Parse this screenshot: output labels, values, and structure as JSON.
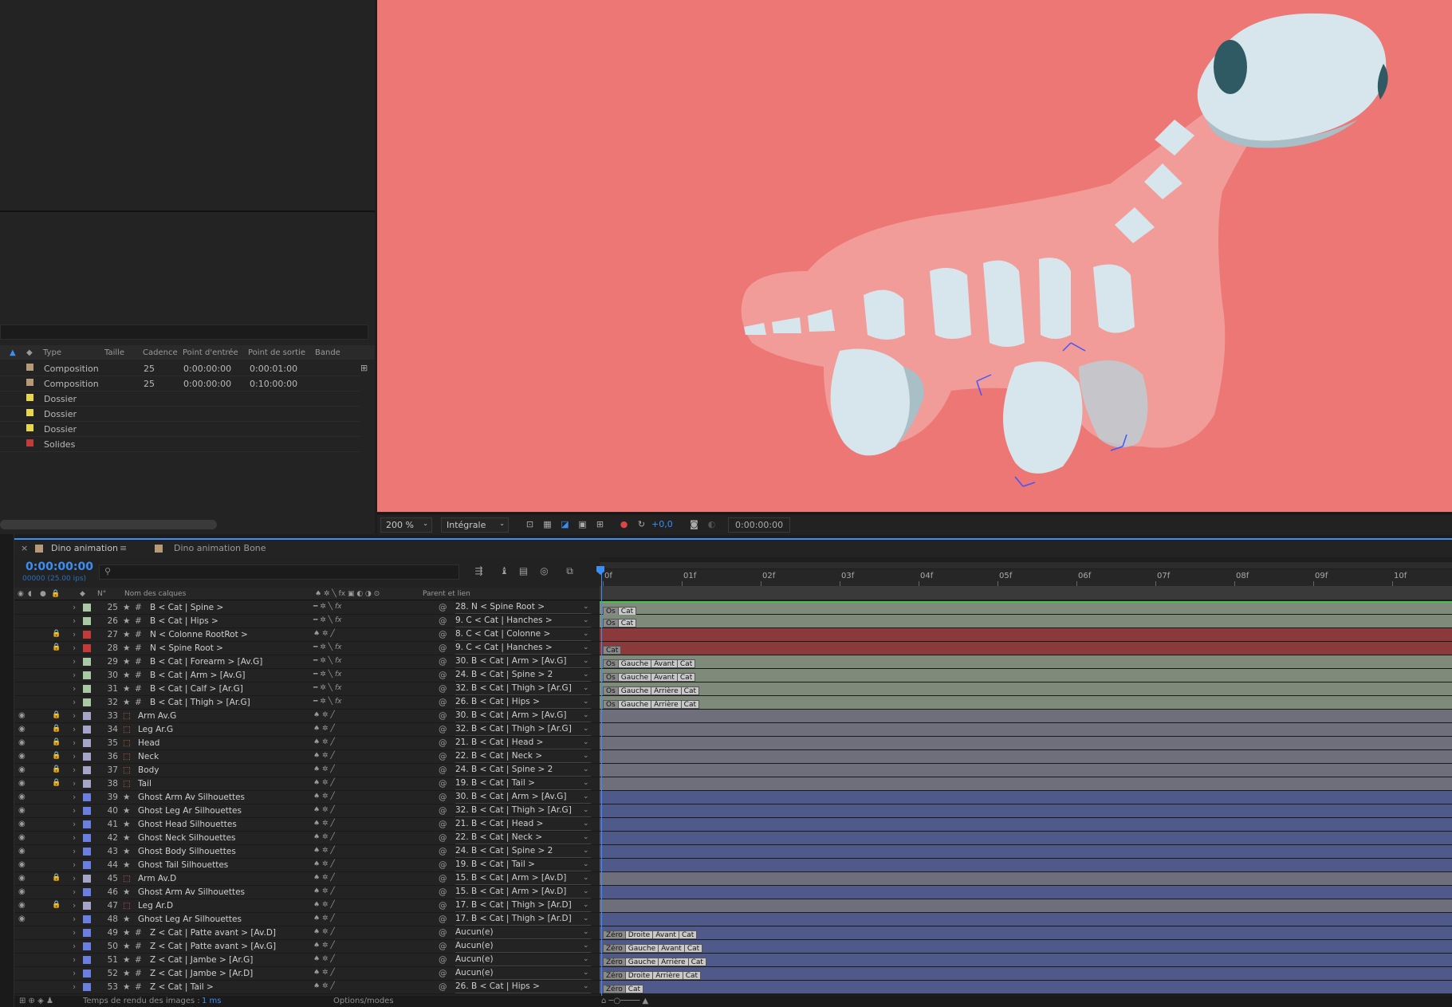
{
  "project": {
    "columns": [
      "Type",
      "Taille",
      "Cadence",
      "Point d'entrée",
      "Point de sortie",
      "Bande"
    ],
    "rows": [
      {
        "type": "Composition",
        "cadence": "25",
        "in": "0:00:00:00",
        "out": "0:00:01:00",
        "color": "#b69a77"
      },
      {
        "type": "Composition",
        "cadence": "25",
        "in": "0:00:00:00",
        "out": "0:10:00:00",
        "color": "#b69a77"
      },
      {
        "type": "Dossier",
        "cadence": "",
        "in": "",
        "out": "",
        "color": "#e5d84a"
      },
      {
        "type": "Dossier",
        "cadence": "",
        "in": "",
        "out": "",
        "color": "#e5d84a"
      },
      {
        "type": "Dossier",
        "cadence": "",
        "in": "",
        "out": "",
        "color": "#e5d84a"
      },
      {
        "type": "Solides",
        "cadence": "",
        "in": "",
        "out": "",
        "color": "#c23b3b"
      }
    ]
  },
  "viewer": {
    "zoom": "200 %",
    "resolution": "Intégrale",
    "exposure": "+0,0",
    "timecode": "0:00:00:00",
    "background_color": "#ec7775"
  },
  "timeline": {
    "tabs": [
      "Dino animation",
      "Dino animation Bone"
    ],
    "current_time": "0:00:00:00",
    "fps": "00000 (25.00 ips)",
    "columns": {
      "num": "N°",
      "name": "Nom des calques",
      "parent": "Parent et lien"
    },
    "ruler": [
      "0f",
      "01f",
      "02f",
      "03f",
      "04f",
      "05f",
      "06f",
      "07f",
      "08f",
      "09f",
      "10f"
    ],
    "footer_render": "Temps de rendu des images :",
    "footer_render_value": "1 ms",
    "footer_toggle": "Options/modes",
    "layers": [
      {
        "num": "25",
        "name": "B < Cat | Spine >",
        "kind": "null",
        "color": "#a9c9a4",
        "eye": false,
        "lock": false,
        "fx": true,
        "parent": "28. N < Spine Root >",
        "bar": "#7e8a7a",
        "tags": [
          "Os",
          "Cat"
        ]
      },
      {
        "num": "26",
        "name": "B < Cat | Hips >",
        "kind": "null",
        "color": "#a9c9a4",
        "eye": false,
        "lock": false,
        "fx": true,
        "parent": "9. C < Cat | Hanches >",
        "bar": "#7e8a7a",
        "tags": [
          "Os",
          "Cat"
        ]
      },
      {
        "num": "27",
        "name": "N < Colonne RootRot >",
        "kind": "null",
        "color": "#c23b3b",
        "eye": false,
        "lock": true,
        "fx": false,
        "parent": "8. C < Cat | Colonne >",
        "bar": "#8a3a3a",
        "tags": []
      },
      {
        "num": "28",
        "name": "N < Spine Root >",
        "kind": "null",
        "color": "#c23b3b",
        "eye": false,
        "lock": true,
        "fx": true,
        "parent": "9. C < Cat | Hanches >",
        "bar": "#8a3a3a",
        "tags": [
          "Cat"
        ]
      },
      {
        "num": "29",
        "name": "B < Cat | Forearm > [Av.G]",
        "kind": "null",
        "color": "#a9c9a4",
        "eye": false,
        "lock": false,
        "fx": true,
        "parent": "30. B < Cat | Arm > [Av.G]",
        "bar": "#7e8a7a",
        "tags": [
          "Os",
          "Gauche",
          "Avant",
          "Cat"
        ]
      },
      {
        "num": "30",
        "name": "B < Cat | Arm > [Av.G]",
        "kind": "null",
        "color": "#a9c9a4",
        "eye": false,
        "lock": false,
        "fx": true,
        "parent": "24. B < Cat | Spine > 2",
        "bar": "#7e8a7a",
        "tags": [
          "Os",
          "Gauche",
          "Avant",
          "Cat"
        ]
      },
      {
        "num": "31",
        "name": "B < Cat | Calf > [Ar.G]",
        "kind": "null",
        "color": "#a9c9a4",
        "eye": false,
        "lock": false,
        "fx": true,
        "parent": "32. B < Cat | Thigh > [Ar.G]",
        "bar": "#7e8a7a",
        "tags": [
          "Os",
          "Gauche",
          "Arrière",
          "Cat"
        ]
      },
      {
        "num": "32",
        "name": "B < Cat | Thigh > [Ar.G]",
        "kind": "null",
        "color": "#a9c9a4",
        "eye": false,
        "lock": false,
        "fx": true,
        "parent": "26. B < Cat | Hips >",
        "bar": "#7e8a7a",
        "tags": [
          "Os",
          "Gauche",
          "Arrière",
          "Cat"
        ]
      },
      {
        "num": "33",
        "name": "Arm Av.G",
        "kind": "shape",
        "color": "#a5a5c8",
        "eye": true,
        "lock": true,
        "fx": false,
        "parent": "30. B < Cat | Arm > [Av.G]",
        "bar": "#6f6f7c",
        "tags": []
      },
      {
        "num": "34",
        "name": "Leg Ar.G",
        "kind": "shape",
        "color": "#a5a5c8",
        "eye": true,
        "lock": true,
        "fx": false,
        "parent": "32. B < Cat | Thigh > [Ar.G]",
        "bar": "#6f6f7c",
        "tags": []
      },
      {
        "num": "35",
        "name": "Head",
        "kind": "shape",
        "color": "#a5a5c8",
        "eye": true,
        "lock": true,
        "fx": false,
        "parent": "21. B < Cat | Head >",
        "bar": "#6f6f7c",
        "tags": []
      },
      {
        "num": "36",
        "name": "Neck",
        "kind": "shape",
        "color": "#a5a5c8",
        "eye": true,
        "lock": true,
        "fx": false,
        "parent": "22. B < Cat | Neck >",
        "bar": "#6f6f7c",
        "tags": []
      },
      {
        "num": "37",
        "name": "Body",
        "kind": "shape",
        "color": "#a5a5c8",
        "eye": true,
        "lock": true,
        "fx": false,
        "parent": "24. B < Cat | Spine > 2",
        "bar": "#6f6f7c",
        "tags": []
      },
      {
        "num": "38",
        "name": "Tail",
        "kind": "shape",
        "color": "#a5a5c8",
        "eye": true,
        "lock": true,
        "fx": false,
        "parent": "19. B < Cat | Tail >",
        "bar": "#6f6f7c",
        "tags": []
      },
      {
        "num": "39",
        "name": "Ghost Arm Av Silhouettes",
        "kind": "star",
        "color": "#6a7fe0",
        "eye": true,
        "lock": false,
        "fx": false,
        "parent": "30. B < Cat | Arm > [Av.G]",
        "bar": "#4f5a8a",
        "tags": []
      },
      {
        "num": "40",
        "name": "Ghost Leg Ar Silhouettes",
        "kind": "star",
        "color": "#6a7fe0",
        "eye": true,
        "lock": false,
        "fx": false,
        "parent": "32. B < Cat | Thigh > [Ar.G]",
        "bar": "#4f5a8a",
        "tags": []
      },
      {
        "num": "41",
        "name": "Ghost Head Silhouettes",
        "kind": "star",
        "color": "#6a7fe0",
        "eye": true,
        "lock": false,
        "fx": false,
        "parent": "21. B < Cat | Head >",
        "bar": "#4f5a8a",
        "tags": []
      },
      {
        "num": "42",
        "name": "Ghost Neck Silhouettes",
        "kind": "star",
        "color": "#6a7fe0",
        "eye": true,
        "lock": false,
        "fx": false,
        "parent": "22. B < Cat | Neck >",
        "bar": "#4f5a8a",
        "tags": []
      },
      {
        "num": "43",
        "name": "Ghost Body Silhouettes",
        "kind": "star",
        "color": "#6a7fe0",
        "eye": true,
        "lock": false,
        "fx": false,
        "parent": "24. B < Cat | Spine > 2",
        "bar": "#4f5a8a",
        "tags": []
      },
      {
        "num": "44",
        "name": "Ghost Tail Silhouettes",
        "kind": "star",
        "color": "#6a7fe0",
        "eye": true,
        "lock": false,
        "fx": false,
        "parent": "19. B < Cat | Tail >",
        "bar": "#4f5a8a",
        "tags": []
      },
      {
        "num": "45",
        "name": "Arm Av.D",
        "kind": "shape",
        "color": "#a5a5c8",
        "eye": true,
        "lock": true,
        "fx": false,
        "parent": "15. B < Cat | Arm > [Av.D]",
        "bar": "#6f6f7c",
        "tags": []
      },
      {
        "num": "46",
        "name": "Ghost Arm Av Silhouettes",
        "kind": "star",
        "color": "#6a7fe0",
        "eye": true,
        "lock": false,
        "fx": false,
        "parent": "15. B < Cat | Arm > [Av.D]",
        "bar": "#4f5a8a",
        "tags": []
      },
      {
        "num": "47",
        "name": "Leg Ar.D",
        "kind": "shape",
        "color": "#a5a5c8",
        "eye": true,
        "lock": true,
        "fx": false,
        "parent": "17. B < Cat | Thigh > [Ar.D]",
        "bar": "#6f6f7c",
        "tags": []
      },
      {
        "num": "48",
        "name": "Ghost Leg Ar Silhouettes",
        "kind": "star",
        "color": "#6a7fe0",
        "eye": true,
        "lock": false,
        "fx": false,
        "parent": "17. B < Cat | Thigh > [Ar.D]",
        "bar": "#4f5a8a",
        "tags": []
      },
      {
        "num": "49",
        "name": "Z < Cat | Patte avant > [Av.D]",
        "kind": "null",
        "color": "#6a7fe0",
        "eye": false,
        "lock": false,
        "fx": false,
        "parent": "Aucun(e)",
        "bar": "#4f5a8a",
        "tags": [
          "Zéro",
          "Droite",
          "Avant",
          "Cat"
        ]
      },
      {
        "num": "50",
        "name": "Z < Cat | Patte avant > [Av.G]",
        "kind": "null",
        "color": "#6a7fe0",
        "eye": false,
        "lock": false,
        "fx": false,
        "parent": "Aucun(e)",
        "bar": "#4f5a8a",
        "tags": [
          "Zéro",
          "Gauche",
          "Avant",
          "Cat"
        ]
      },
      {
        "num": "51",
        "name": "Z < Cat | Jambe > [Ar.G]",
        "kind": "null",
        "color": "#6a7fe0",
        "eye": false,
        "lock": false,
        "fx": false,
        "parent": "Aucun(e)",
        "bar": "#4f5a8a",
        "tags": [
          "Zéro",
          "Gauche",
          "Arrière",
          "Cat"
        ]
      },
      {
        "num": "52",
        "name": "Z < Cat | Jambe > [Ar.D]",
        "kind": "null",
        "color": "#6a7fe0",
        "eye": false,
        "lock": false,
        "fx": false,
        "parent": "Aucun(e)",
        "bar": "#4f5a8a",
        "tags": [
          "Zéro",
          "Droite",
          "Arrière",
          "Cat"
        ]
      },
      {
        "num": "53",
        "name": "Z < Cat | Tail >",
        "kind": "null",
        "color": "#6a7fe0",
        "eye": false,
        "lock": false,
        "fx": false,
        "parent": "26. B < Cat | Hips >",
        "bar": "#4f5a8a",
        "tags": [
          "Zéro",
          "Cat"
        ]
      }
    ]
  }
}
